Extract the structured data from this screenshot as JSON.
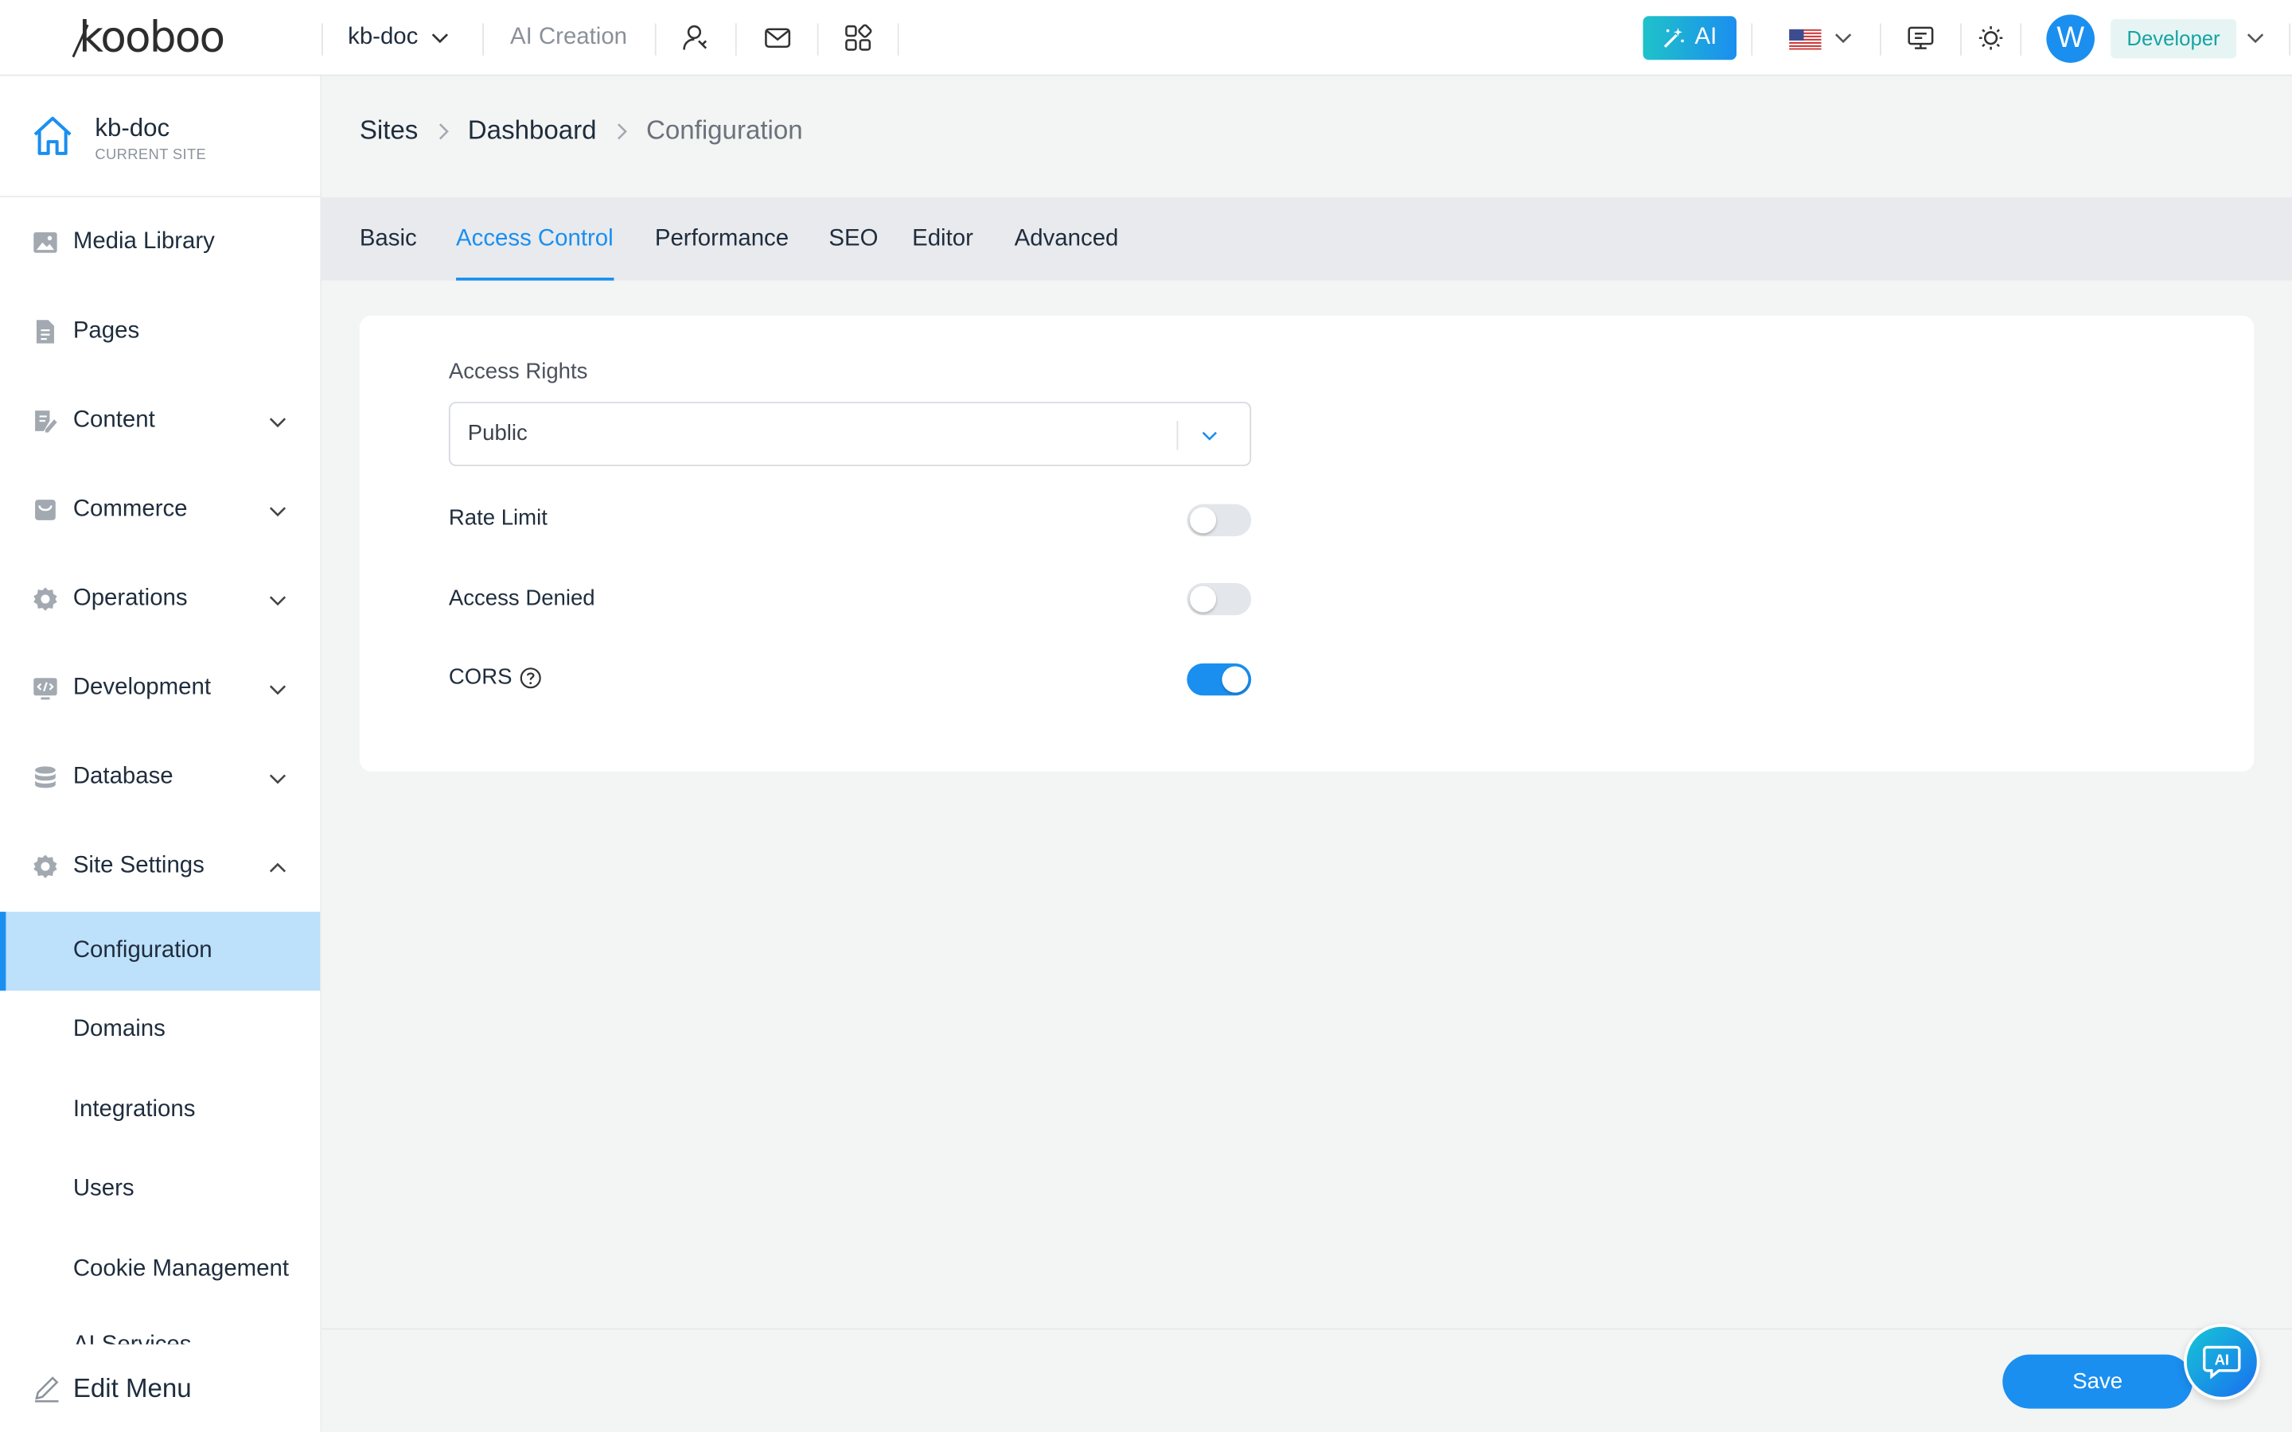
{
  "brand": {
    "logo_text": "kooboo"
  },
  "topbar": {
    "site_name": "kb-doc",
    "ai_creation": "AI Creation",
    "ai_button": "AI",
    "avatar_initial": "W",
    "role": "Developer",
    "icons": [
      "user-switch-icon",
      "mail-icon",
      "apps-grid-icon",
      "monitor-chat-icon",
      "sun-icon"
    ]
  },
  "sidebar": {
    "site_name": "kb-doc",
    "site_sub": "CURRENT SITE",
    "items": [
      {
        "label": "Media Library",
        "icon": "image-icon"
      },
      {
        "label": "Pages",
        "icon": "file-icon"
      },
      {
        "label": "Content",
        "icon": "edit-doc-icon",
        "expandable": true
      },
      {
        "label": "Commerce",
        "icon": "shop-icon",
        "expandable": true
      },
      {
        "label": "Operations",
        "icon": "gear-icon",
        "expandable": true
      },
      {
        "label": "Development",
        "icon": "code-icon",
        "expandable": true
      },
      {
        "label": "Database",
        "icon": "database-icon",
        "expandable": true
      },
      {
        "label": "Site Settings",
        "icon": "gear-icon",
        "expandable": true,
        "expanded": true
      }
    ],
    "sub_items": [
      {
        "label": "Configuration",
        "active": true
      },
      {
        "label": "Domains"
      },
      {
        "label": "Integrations"
      },
      {
        "label": "Users"
      },
      {
        "label": "Cookie Management"
      }
    ],
    "cut_off_label": "AI Services",
    "edit_menu": "Edit Menu"
  },
  "breadcrumb": [
    "Sites",
    "Dashboard",
    "Configuration"
  ],
  "tabs": [
    {
      "label": "Basic"
    },
    {
      "label": "Access Control",
      "active": true
    },
    {
      "label": "Performance"
    },
    {
      "label": "SEO"
    },
    {
      "label": "Editor"
    },
    {
      "label": "Advanced"
    }
  ],
  "form": {
    "access_rights_label": "Access Rights",
    "access_rights_value": "Public",
    "rate_limit_label": "Rate Limit",
    "rate_limit_on": false,
    "access_denied_label": "Access Denied",
    "access_denied_on": false,
    "cors_label": "CORS",
    "cors_on": true
  },
  "footer": {
    "save": "Save",
    "ai_chat": "AI"
  },
  "colors": {
    "accent": "#1a8ff0",
    "active_bg": "#bde0fb",
    "role_text": "#17a3a3"
  }
}
